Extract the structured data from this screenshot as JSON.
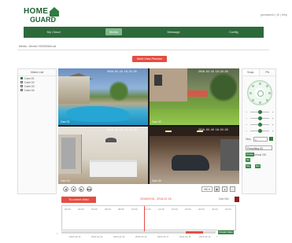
{
  "header": {
    "logo_line1": "HOME",
    "logo_line2": "GUARD",
    "user_text": "guestadmin | ⚙ | Help"
  },
  "nav": {
    "items": [
      {
        "label": "My Cloud"
      },
      {
        "label": "Media"
      },
      {
        "label": "Message"
      },
      {
        "label": "Config"
      }
    ],
    "active_index": 1
  },
  "breadcrumb": "Media - Device HGDSNM4-uA",
  "multiview_button": "Multi-View Preview",
  "video_list": {
    "title": "Video List",
    "items": [
      {
        "label": "Cam 01",
        "checked": true
      },
      {
        "label": "Cam 02",
        "checked": false
      },
      {
        "label": "Cam 03",
        "checked": false
      },
      {
        "label": "Cam 04",
        "checked": false
      }
    ]
  },
  "tiles": [
    {
      "timestamp": "2016-02-18 16:22:28",
      "cam": "Cam 01"
    },
    {
      "timestamp": "2016-02-18 16:22:28",
      "cam": "Cam 02"
    },
    {
      "timestamp": "2016-02-18 16:22:28",
      "cam": "Cam 03"
    },
    {
      "timestamp": "2016-02-18 16:22:28",
      "cam": "Cam 04"
    }
  ],
  "controls": {
    "left_buttons": [
      "◀",
      "■",
      "▶",
      "▶▶"
    ],
    "quality": "HD ▾"
  },
  "ptz": {
    "tabs": [
      "Snap",
      "Pb"
    ],
    "preset_label": "Step",
    "preset_value": "1",
    "select_value": "Presetting 00",
    "cruise_label": "Cruise",
    "go_label": "Go",
    "set_label": "Set",
    "del_label": "Del",
    "preset_note": "Default 200"
  },
  "timeline": {
    "button": "To current video",
    "date": "2016/02/18 - 2016-02-18",
    "zoom": "Max  Min",
    "ticks": [
      "00:00",
      "02:00",
      "04:00",
      "06:00",
      "08:00",
      "10:00",
      "12:00",
      "14:00",
      "16:00",
      "18:00",
      "20:00",
      "22:00",
      "24:00"
    ],
    "day_labels": [
      "2016-02-13",
      "2016-02-14",
      "2016-02-15",
      "2016-02-16",
      "2016-02-17",
      "2016-02-18",
      "2016-02-19"
    ],
    "apply_label": "Create Video"
  },
  "colors": {
    "brand_green": "#2d6a3a",
    "accent_red": "#e54d42"
  }
}
